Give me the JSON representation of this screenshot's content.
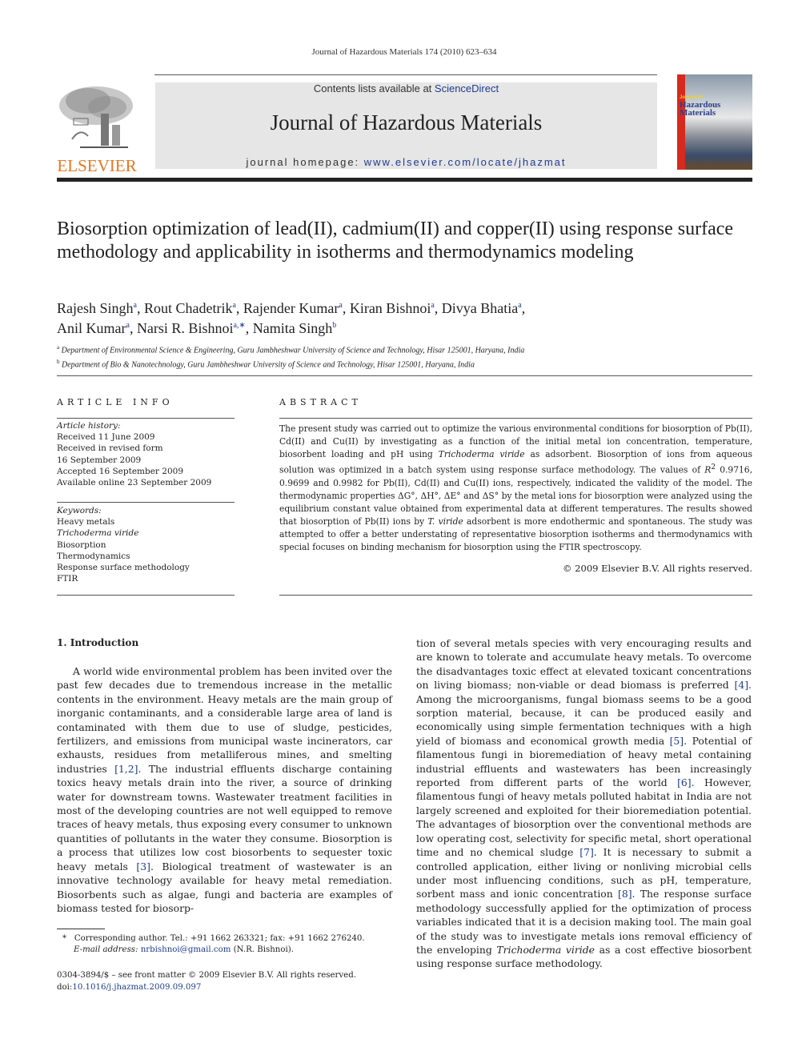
{
  "running_head": "Journal of Hazardous Materials 174 (2010) 623–634",
  "header": {
    "publisher_logo_text": "ELSEVIER",
    "contents_prefix": "Contents lists available at ",
    "contents_link": "ScienceDirect",
    "journal_title": "Journal of Hazardous Materials",
    "homepage_prefix": "journal homepage: ",
    "homepage_link": "www.elsevier.com/locate/jhazmat",
    "cover_line1": "Journal of",
    "cover_line2": "Hazardous",
    "cover_line3": "Materials"
  },
  "article": {
    "title": "Biosorption optimization of lead(II), cadmium(II) and copper(II) using response surface methodology and applicability in isotherms and thermodynamics modeling",
    "authors": [
      {
        "name": "Rajesh Singh",
        "sup": "a"
      },
      {
        "name": "Rout Chadetrik",
        "sup": "a"
      },
      {
        "name": "Rajender Kumar",
        "sup": "a"
      },
      {
        "name": "Kiran Bishnoi",
        "sup": "a"
      },
      {
        "name": "Divya Bhatia",
        "sup": "a"
      },
      {
        "name": "Anil Kumar",
        "sup": "a"
      },
      {
        "name": "Narsi R. Bishnoi",
        "sup": "a,∗"
      },
      {
        "name": "Namita Singh",
        "sup": "b"
      }
    ],
    "affiliations": [
      {
        "sup": "a",
        "text": "Department of Environmental Science & Engineering, Guru Jambheshwar University of Science and Technology, Hisar 125001, Haryana, India"
      },
      {
        "sup": "b",
        "text": "Department of Bio & Nanotechnology, Guru Jambheshwar University of Science and Technology, Hisar 125001, Haryana, India"
      }
    ]
  },
  "article_info": {
    "heading": "ARTICLE INFO",
    "history_label": "Article history:",
    "history": [
      "Received 11 June 2009",
      "Received in revised form",
      "16 September 2009",
      "Accepted 16 September 2009",
      "Available online 23 September 2009"
    ],
    "keywords_label": "Keywords:",
    "keywords": [
      "Heavy metals",
      "Trichoderma viride",
      "Biosorption",
      "Thermodynamics",
      "Response surface methodology",
      "FTIR"
    ]
  },
  "abstract": {
    "heading": "ABSTRACT",
    "p1": "The present study was carried out to optimize the various environmental conditions for biosorption of Pb(II), Cd(II) and Cu(II) by investigating as a function of the initial metal ion concentration, temperature, biosorbent loading and pH using ",
    "species": "Trichoderma viride",
    "p2": " as adsorbent. Biosorption of ions from aqueous solution was optimized in a batch system using response surface methodology. The values of ",
    "r2": "R",
    "r2_sup": "2",
    "p3": " 0.9716, 0.9699 and 0.9982 for Pb(II), Cd(II) and Cu(II) ions, respectively, indicated the validity of the model. The thermodynamic properties ΔG°, ΔH°, ΔE° and ΔS° by the metal ions for biosorption were analyzed using the equilibrium constant value obtained from experimental data at different temperatures. The results showed that biosorption of Pb(II) ions by ",
    "species_short": "T. viride",
    "p4": " adsorbent is more endothermic and spontaneous. The study was attempted to offer a better understating of representative biosorption isotherms and thermodynamics with special focuses on binding mechanism for biosorption using the FTIR spectroscopy.",
    "copyright": "© 2009 Elsevier B.V. All rights reserved."
  },
  "introduction": {
    "heading": "1.  Introduction",
    "col1": [
      {
        "t": "A world wide environmental problem has been invited over the past few decades due to tremendous increase in the metallic contents in the environment. Heavy metals are the main group of inorganic contaminants, and a considerable large area of land is contaminated with them due to use of sludge, pesticides, fertilizers, and emissions from municipal waste incinerators, car exhausts, residues from metalliferous mines, and smelting industries "
      },
      {
        "ref": "[1,2]"
      },
      {
        "t": ". The industrial effluents discharge containing toxics heavy metals drain into the river, a source of drinking water for downstream towns. Wastewater treatment facilities in most of the developing countries are not well equipped to remove traces of heavy metals, thus exposing every consumer to unknown quantities of pollutants in the water they consume. Biosorption is a process that utilizes low cost biosorbents to sequester toxic heavy metals "
      },
      {
        "ref": "[3]"
      },
      {
        "t": ". Biological treatment of wastewater is an innovative technology available for heavy metal remediation. Biosorbents such as algae, fungi and bacteria are examples of biomass tested for biosorp-"
      }
    ],
    "col2": [
      {
        "t": "tion of several metals species with very encouraging results and are known to tolerate and accumulate heavy metals. To overcome the disadvantages toxic effect at elevated toxicant concentrations on living biomass; non-viable or dead biomass is preferred "
      },
      {
        "ref": "[4]"
      },
      {
        "t": ". Among the microorganisms, fungal biomass seems to be a good sorption material, because, it can be produced easily and economically using simple fermentation techniques with a high yield of biomass and economical growth media "
      },
      {
        "ref": "[5]"
      },
      {
        "t": ". Potential of filamentous fungi in bioremediation of heavy metal containing industrial effluents and wastewaters has been increasingly reported from different parts of the world "
      },
      {
        "ref": "[6]"
      },
      {
        "t": ". However, filamentous fungi of heavy metals polluted habitat in India are not largely screened and exploited for their bioremediation potential. The advantages of biosorption over the conventional methods are low operating cost, selectivity for specific metal, short operational time and no chemical sludge "
      },
      {
        "ref": "[7]"
      },
      {
        "t": ". It is necessary to submit a controlled application, either living or nonliving microbial cells under most influencing conditions, such as pH, temperature, sorbent mass and ionic concentration "
      },
      {
        "ref": "[8]"
      },
      {
        "t": ". The response surface methodology successfully applied for the optimization of process variables indicated that it is a decision making tool. The main goal of the study was to investigate metals ions removal efficiency of the enveloping "
      },
      {
        "it": "Trichoderma viride"
      },
      {
        "t": " as a cost effective biosorbent using response surface methodology."
      }
    ]
  },
  "footnote": {
    "star": "*",
    "corresponding": "Corresponding author. Tel.: +91 1662 263321; fax: +91 1662 276240.",
    "email_label": "E-mail address:",
    "email": "nrbishnoi@gmail.com",
    "email_suffix": " (N.R. Bishnoi).",
    "front_matter": "0304-3894/$ – see front matter © 2009 Elsevier B.V. All rights reserved.",
    "doi_prefix": "doi:",
    "doi": "10.1016/j.jhazmat.2009.09.097"
  }
}
